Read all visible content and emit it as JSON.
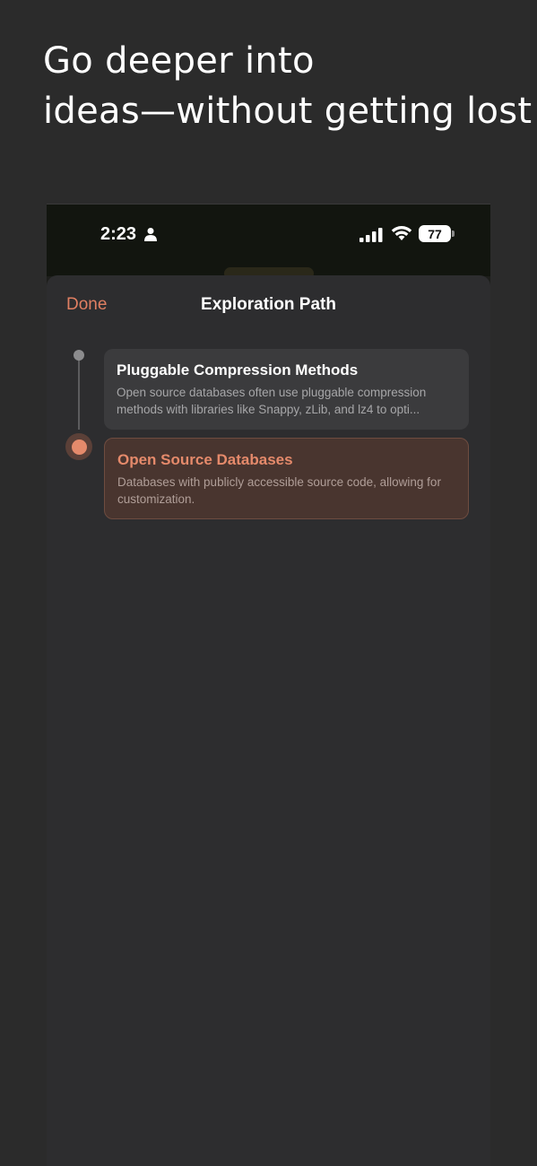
{
  "promo": {
    "headline_line1": "Go deeper into",
    "headline_line2": "ideas—without getting lost"
  },
  "status_bar": {
    "time": "2:23",
    "battery": "77",
    "icons": [
      "person-icon",
      "cellular-signal-icon",
      "wifi-icon",
      "battery-icon"
    ]
  },
  "sheet": {
    "done_label": "Done",
    "title": "Exploration Path"
  },
  "path": {
    "items": [
      {
        "title": "Pluggable Compression Methods",
        "description": "Open source databases often use pluggable compression methods with libraries like Snappy, zLib, and lz4 to opti...",
        "active": false
      },
      {
        "title": "Open Source Databases",
        "description": "Databases with publicly accessible source code, allowing for customization.",
        "active": true
      }
    ]
  },
  "colors": {
    "background": "#2b2b2b",
    "sheet": "#2d2d2f",
    "accent": "#e07f62",
    "active_card_bg": "#49352f",
    "inactive_card_bg": "#3b3b3d"
  }
}
